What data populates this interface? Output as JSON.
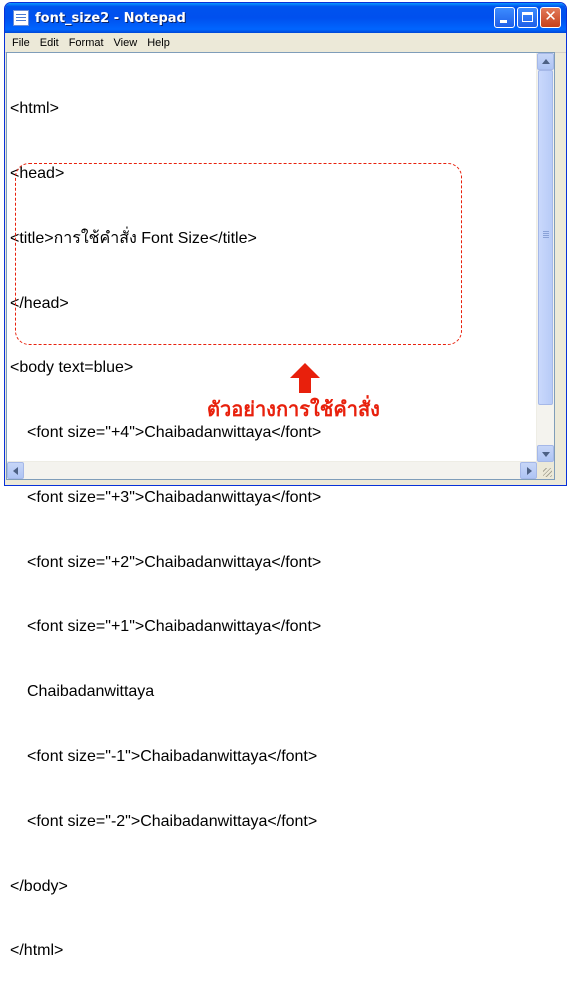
{
  "window": {
    "title": "font_size2 - Notepad"
  },
  "menu": {
    "items": [
      "File",
      "Edit",
      "Format",
      "View",
      "Help"
    ]
  },
  "editor": {
    "lines": [
      "<html>",
      "<head>",
      "<title>การใช้คำสั่ง Font Size</title>",
      "</head>",
      "<body text=blue>",
      "<font size=\"+4\">Chaibadanwittaya</font>",
      "<font size=\"+3\">Chaibadanwittaya</font>",
      "<font size=\"+2\">Chaibadanwittaya</font>",
      "<font size=\"+1\">Chaibadanwittaya</font>",
      "Chaibadanwittaya",
      "<font size=\"-1\">Chaibadanwittaya</font>",
      "<font size=\"-2\">Chaibadanwittaya</font>",
      "</body>",
      "</html>"
    ]
  },
  "annotation": {
    "text": "ตัวอย่างการใช้คำสั่ง",
    "color": "#e8200c"
  },
  "icons": {
    "app": "notepad-icon",
    "minimize": "minimize-icon",
    "maximize": "maximize-icon",
    "close": "close-icon",
    "arrow": "up-arrow-icon"
  }
}
